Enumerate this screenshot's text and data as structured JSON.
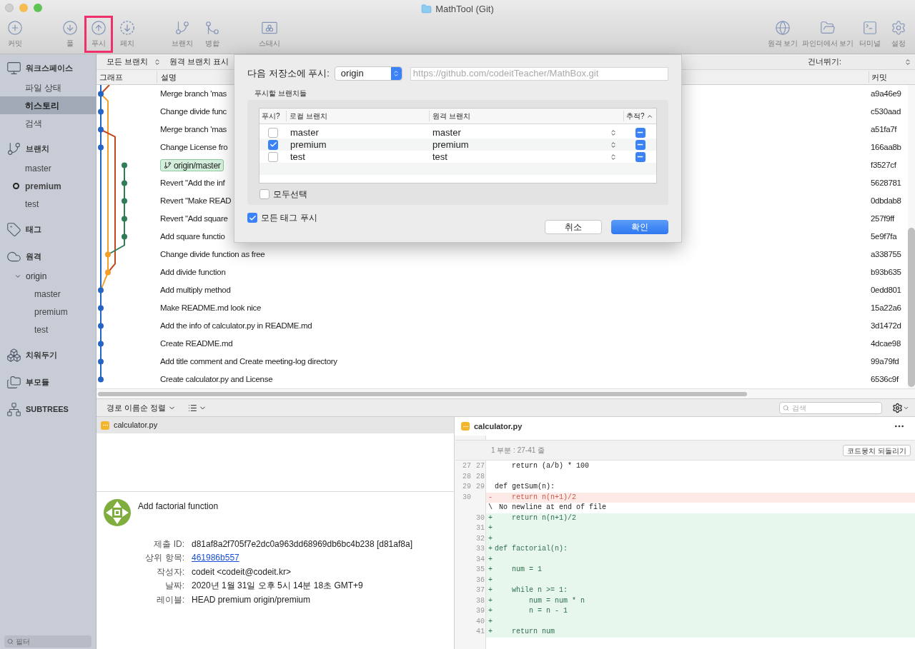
{
  "window": {
    "title": "MathTool (Git)"
  },
  "toolbar": {
    "left": [
      {
        "kind": "commit",
        "label": "커밋",
        "highlighted": false
      },
      {
        "kind": "pull",
        "label": "풀",
        "highlighted": false
      },
      {
        "kind": "push",
        "label": "푸시",
        "highlighted": true
      },
      {
        "kind": "fetch",
        "label": "페치",
        "highlighted": false
      },
      {
        "kind": "branch",
        "label": "브랜치",
        "highlighted": false
      },
      {
        "kind": "merge",
        "label": "병합",
        "highlighted": false
      },
      {
        "kind": "stash",
        "label": "스태시",
        "highlighted": false
      }
    ],
    "right": [
      {
        "kind": "remote",
        "label": "원격 보기"
      },
      {
        "kind": "finder",
        "label": "파인더에서 보기"
      },
      {
        "kind": "terminal",
        "label": "터미널"
      },
      {
        "kind": "settings",
        "label": "설정"
      }
    ]
  },
  "sidebar": {
    "sections": [
      {
        "kind": "workspace",
        "label": "워크스페이스",
        "children": [
          {
            "label": "파일 상태",
            "selected": false
          },
          {
            "label": "히스토리",
            "selected": true
          },
          {
            "label": "검색",
            "selected": false
          }
        ]
      },
      {
        "kind": "branches",
        "label": "브랜치",
        "children": [
          {
            "label": "master",
            "current": false
          },
          {
            "label": "premium",
            "current": true
          },
          {
            "label": "test",
            "current": false
          }
        ]
      },
      {
        "kind": "tags",
        "label": "태그"
      },
      {
        "kind": "remotes",
        "label": "원격",
        "children": [
          {
            "label": "origin",
            "expanded": true,
            "children": [
              {
                "label": "master"
              },
              {
                "label": "premium"
              },
              {
                "label": "test"
              }
            ]
          }
        ]
      },
      {
        "kind": "stashes",
        "label": "치워두기"
      },
      {
        "kind": "submodules",
        "label": "부모듈"
      },
      {
        "kind": "subtrees",
        "label": "SUBTREES"
      }
    ],
    "filter_placeholder": "필터"
  },
  "history": {
    "branch_filter": "모든 브랜치",
    "remote_toggle": "원격 브랜치 표시",
    "skip_label": "건너뛰기:",
    "columns": [
      "그래프",
      "설명",
      "커밋"
    ],
    "rows": [
      {
        "description": "Merge branch 'mas",
        "commit": "a9a46e9"
      },
      {
        "description": "Change divide func",
        "commit": "c530aad"
      },
      {
        "description": "Merge branch 'mas",
        "commit": "a51fa7f"
      },
      {
        "description": "Change License fro",
        "commit": "166aa8b"
      },
      {
        "tags": [
          "origin/master"
        ],
        "commit": "f3527cf"
      },
      {
        "description": "Revert \"Add the inf",
        "commit": "5628781"
      },
      {
        "description": "Revert \"Make READ",
        "commit": "0dbdab8"
      },
      {
        "description": "Revert \"Add square",
        "commit": "257f9ff"
      },
      {
        "description": "Add square functio",
        "commit": "5e9f7fa"
      },
      {
        "description": "Change divide function as free",
        "commit": "a338755"
      },
      {
        "description": "Add divide function",
        "commit": "b93b635"
      },
      {
        "description": "Add multiply method",
        "commit": "0edd801"
      },
      {
        "description": "Make README.md look nice",
        "commit": "15a22a6"
      },
      {
        "description": "Add the info of calculator.py in README.md",
        "commit": "3d1472d"
      },
      {
        "description": "Create README.md",
        "commit": "4dcae98"
      },
      {
        "description": "Add title comment and Create meeting-log directory",
        "commit": "99a79fd"
      },
      {
        "description": "Create calculator.py and License",
        "commit": "6536c9f"
      }
    ]
  },
  "push_dialog": {
    "repo_label": "다음 저장소에 푸시:",
    "remote": "origin",
    "url": "https://github.com/codeitTeacher/MathBox.git",
    "group_label": "푸시할 브랜치들",
    "columns": [
      "푸시?",
      "로컬 브랜치",
      "원격 브랜치",
      "추적?"
    ],
    "branches": [
      {
        "checked": false,
        "local": "master",
        "remote": "master",
        "tracked": true
      },
      {
        "checked": true,
        "local": "premium",
        "remote": "premium",
        "tracked": true
      },
      {
        "checked": false,
        "local": "test",
        "remote": "test",
        "tracked": true
      }
    ],
    "select_all": {
      "label": "모두선택",
      "checked": false
    },
    "push_tags": {
      "label": "모든 태그 푸시",
      "checked": true
    },
    "buttons": [
      {
        "label": "취소",
        "default": false
      },
      {
        "label": "확인",
        "default": true
      }
    ]
  },
  "bottom_bar": {
    "sort": "경로 이름순 정렬",
    "search_placeholder": "검색"
  },
  "files": [
    {
      "name": "calculator.py"
    }
  ],
  "commit": {
    "message": "Add factorial function",
    "fields": [
      {
        "label": "제출 ID:",
        "value": "d81af8a2f705f7e2dc0a963dd68969db6bc4b238 [d81af8a]",
        "kind": "text"
      },
      {
        "label": "상위 항목:",
        "value": "461986b557",
        "kind": "link"
      },
      {
        "label": "작성자:",
        "value": "codeit <codeit@codeit.kr>",
        "kind": "text"
      },
      {
        "label": "날짜:",
        "value": "2020년 1월 31일 오후 5시 14분 18초 GMT+9",
        "kind": "text"
      },
      {
        "label": "레이블:",
        "value": "HEAD premium origin/premium",
        "kind": "text"
      }
    ]
  },
  "diff": {
    "file": "calculator.py",
    "hunk": "1 부분 : 27-41 줄",
    "revert_button": "코드뭉치 되돌리기",
    "lines": [
      {
        "kind": "context",
        "old": "27",
        "new": "27",
        "text": "    return (a/b) * 100"
      },
      {
        "kind": "context",
        "old": "28",
        "new": "28"
      },
      {
        "kind": "context",
        "old": "29",
        "new": "29",
        "text": "def getSum(n):"
      },
      {
        "kind": "removed",
        "old": "30",
        "marker": "-",
        "text": "    return n(n+1)/2"
      },
      {
        "kind": "note",
        "marker": "\\",
        "text": "No newline at end of file"
      },
      {
        "kind": "added",
        "new": "30",
        "marker": "+",
        "text": "    return n(n+1)/2"
      },
      {
        "kind": "added",
        "new": "31",
        "marker": "+"
      },
      {
        "kind": "added",
        "new": "32",
        "marker": "+"
      },
      {
        "kind": "added",
        "new": "33",
        "marker": "+",
        "text": "def factorial(n):"
      },
      {
        "kind": "added",
        "new": "34",
        "marker": "+"
      },
      {
        "kind": "added",
        "new": "35",
        "marker": "+",
        "text": "    num = 1"
      },
      {
        "kind": "added",
        "new": "36",
        "marker": "+"
      },
      {
        "kind": "added",
        "new": "37",
        "marker": "+",
        "text": "    while n >= 1:"
      },
      {
        "kind": "added",
        "new": "38",
        "marker": "+",
        "text": "        num = num * n"
      },
      {
        "kind": "added",
        "new": "39",
        "marker": "+",
        "text": "        n = n - 1"
      },
      {
        "kind": "added",
        "new": "40",
        "marker": "+"
      },
      {
        "kind": "added",
        "new": "41",
        "marker": "+",
        "text": "    return num"
      }
    ]
  }
}
